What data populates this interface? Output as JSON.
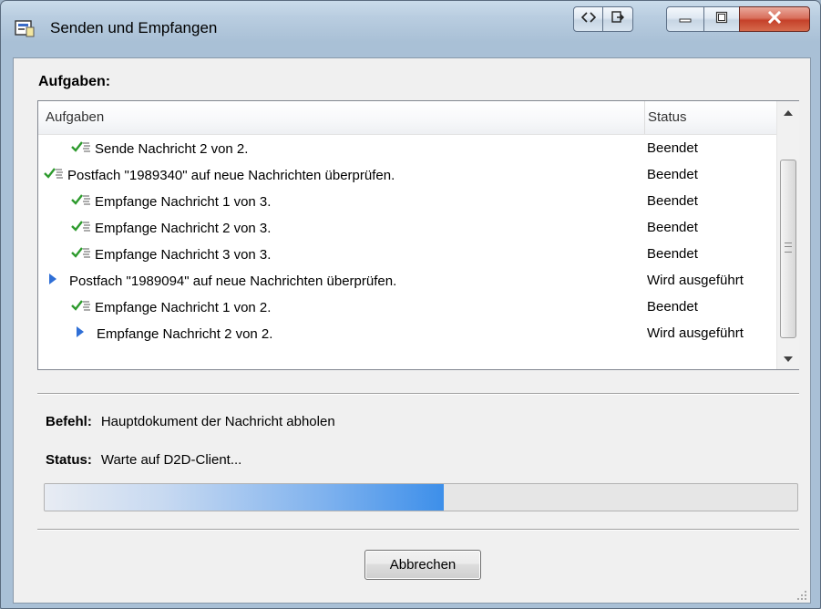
{
  "window": {
    "title": "Senden und Empfangen",
    "accent_color": "#3d8fea"
  },
  "titlebar_buttons": [
    {
      "name": "nav-back-forward",
      "icon": "arrows-icon"
    },
    {
      "name": "pin",
      "icon": "pin-icon"
    },
    {
      "name": "minimize",
      "icon": "minimize-icon"
    },
    {
      "name": "maximize",
      "icon": "maximize-icon"
    },
    {
      "name": "close",
      "icon": "close-icon"
    }
  ],
  "tasks": {
    "section_label": "Aufgaben:",
    "columns": [
      "Aufgaben",
      "Status"
    ],
    "rows": [
      {
        "indent": 1,
        "icon": "check",
        "name": "Sende Nachricht 2 von 2.",
        "status": "Beendet"
      },
      {
        "indent": 0,
        "icon": "check",
        "name": "Postfach \"1989340\" auf neue Nachrichten überprüfen.",
        "status": "Beendet"
      },
      {
        "indent": 1,
        "icon": "check",
        "name": "Empfange Nachricht 1 von 3.",
        "status": "Beendet"
      },
      {
        "indent": 1,
        "icon": "check",
        "name": "Empfange Nachricht 2 von 3.",
        "status": "Beendet"
      },
      {
        "indent": 1,
        "icon": "check",
        "name": "Empfange Nachricht 3 von 3.",
        "status": "Beendet"
      },
      {
        "indent": 0,
        "icon": "arrow",
        "name": "Postfach \"1989094\" auf neue Nachrichten überprüfen.",
        "status": "Wird ausgeführt"
      },
      {
        "indent": 1,
        "icon": "check",
        "name": "Empfange Nachricht 1 von 2.",
        "status": "Beendet"
      },
      {
        "indent": 1,
        "icon": "arrow",
        "name": "Empfange Nachricht 2 von 2.",
        "status": "Wird ausgeführt"
      }
    ]
  },
  "details": {
    "command_label": "Befehl:",
    "command_value": "Hauptdokument der Nachricht abholen",
    "status_label": "Status:",
    "status_value": "Warte auf D2D-Client..."
  },
  "progress": {
    "fraction": 0.53
  },
  "actions": {
    "cancel_label": "Abbrechen"
  }
}
